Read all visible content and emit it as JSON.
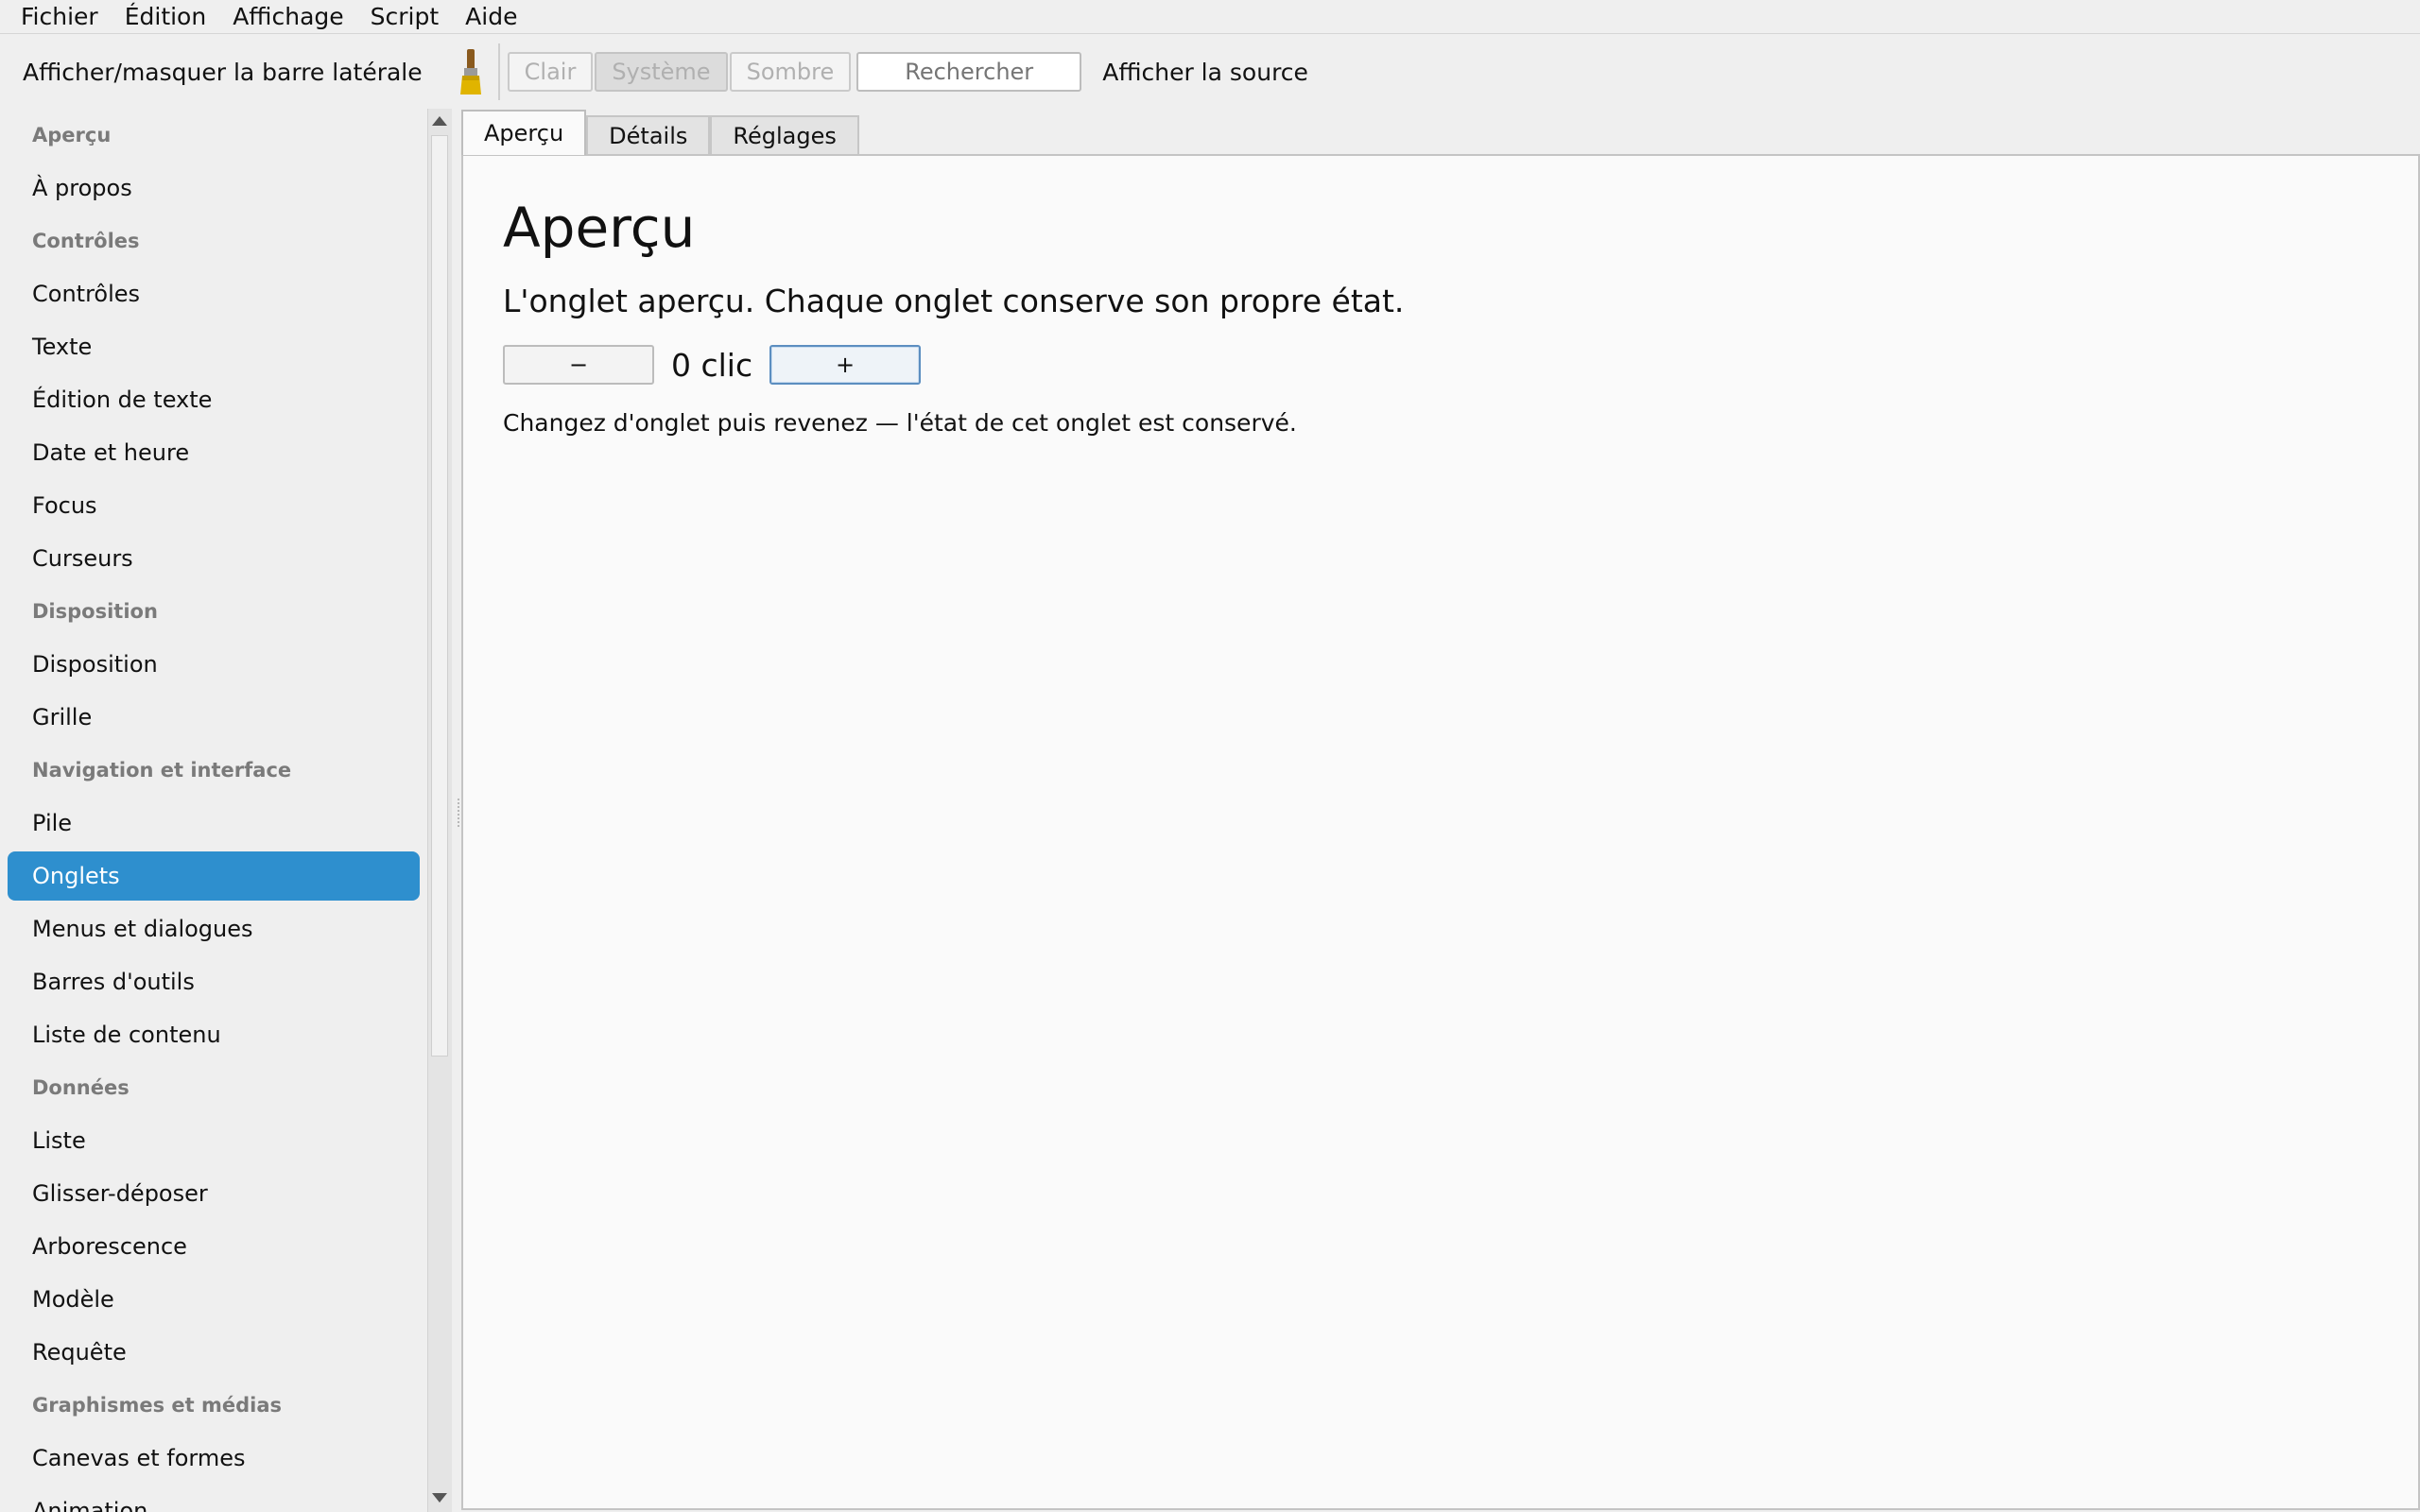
{
  "menubar": {
    "items": [
      "Fichier",
      "Édition",
      "Affichage",
      "Script",
      "Aide"
    ]
  },
  "toolbar": {
    "toggle_sidebar_label": "Afficher/masquer la barre latérale",
    "theme_buttons": [
      "Clair",
      "Système",
      "Sombre"
    ],
    "active_theme": "Système",
    "search_placeholder": "Rechercher",
    "show_source_label": "Afficher la source"
  },
  "sidebar": {
    "entries": [
      {
        "kind": "section",
        "label": "Aperçu"
      },
      {
        "kind": "item",
        "label": "À propos"
      },
      {
        "kind": "section",
        "label": "Contrôles"
      },
      {
        "kind": "item",
        "label": "Contrôles"
      },
      {
        "kind": "item",
        "label": "Texte"
      },
      {
        "kind": "item",
        "label": "Édition de texte"
      },
      {
        "kind": "item",
        "label": "Date et heure"
      },
      {
        "kind": "item",
        "label": "Focus"
      },
      {
        "kind": "item",
        "label": "Curseurs"
      },
      {
        "kind": "section",
        "label": "Disposition"
      },
      {
        "kind": "item",
        "label": "Disposition"
      },
      {
        "kind": "item",
        "label": "Grille"
      },
      {
        "kind": "section",
        "label": "Navigation et interface"
      },
      {
        "kind": "item",
        "label": "Pile"
      },
      {
        "kind": "item",
        "label": "Onglets",
        "selected": true
      },
      {
        "kind": "item",
        "label": "Menus et dialogues"
      },
      {
        "kind": "item",
        "label": "Barres d'outils"
      },
      {
        "kind": "item",
        "label": "Liste de contenu"
      },
      {
        "kind": "section",
        "label": "Données"
      },
      {
        "kind": "item",
        "label": "Liste"
      },
      {
        "kind": "item",
        "label": "Glisser-déposer"
      },
      {
        "kind": "item",
        "label": "Arborescence"
      },
      {
        "kind": "item",
        "label": "Modèle"
      },
      {
        "kind": "item",
        "label": "Requête"
      },
      {
        "kind": "section",
        "label": "Graphismes et médias"
      },
      {
        "kind": "item",
        "label": "Canevas et formes"
      },
      {
        "kind": "item",
        "label": "Animation"
      }
    ]
  },
  "tabs": {
    "items": [
      "Aperçu",
      "Détails",
      "Réglages"
    ],
    "active": "Aperçu"
  },
  "panel": {
    "heading": "Aperçu",
    "lead": "L'onglet aperçu. Chaque onglet conserve son propre état.",
    "decrement_label": "−",
    "increment_label": "+",
    "count_text": "0 clic",
    "hint": "Changez d'onglet puis revenez — l'état de cet onglet est conservé."
  },
  "colors": {
    "accent": "#2e8fce",
    "background": "#efefef",
    "panel": "#fafafa"
  },
  "icons": {
    "theme_brush": "paintbrush-icon"
  }
}
